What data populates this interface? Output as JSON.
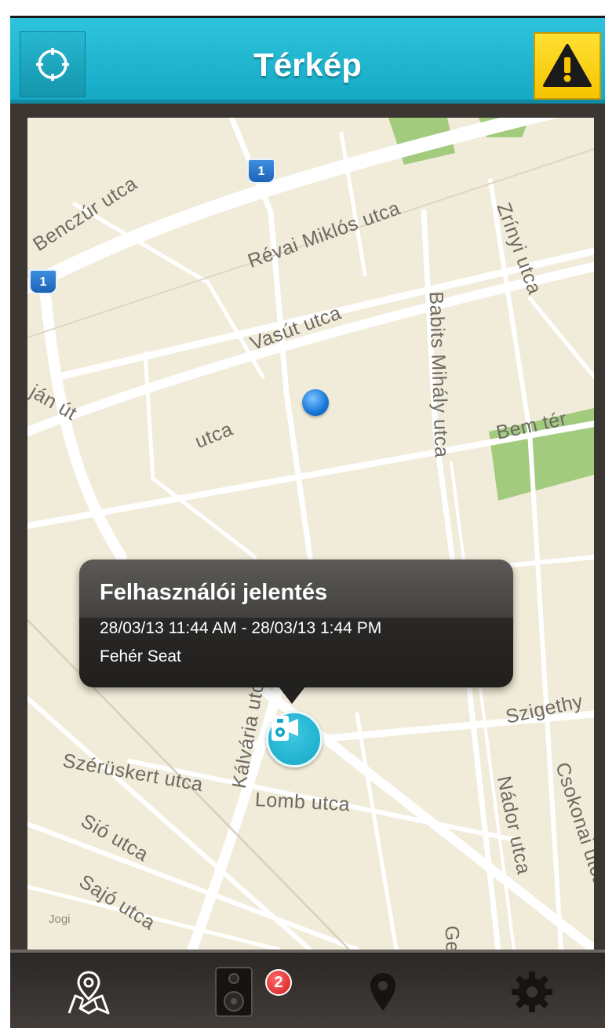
{
  "header": {
    "title": "Térkép"
  },
  "map": {
    "streets": [
      "Benczúr utca",
      "Révai Miklós utca",
      "Zrínyi utca",
      "Vasút utca",
      "Babits Mihály utca",
      "Bem tér",
      "ján út",
      "utca",
      "utca",
      "Kálvária utca",
      "Szigethy",
      "Szérüskert utca",
      "Lomb utca",
      "Nádor utca",
      "Csokonai utca",
      "Sió utca",
      "Sajó utca",
      "Ger"
    ],
    "route_shields": [
      "1",
      "1"
    ],
    "attribution": "Jogi"
  },
  "callout": {
    "title": "Felhasználói jelentés",
    "time_range": "28/03/13 11:44 AM - 28/03/13 1:44 PM",
    "description": "Fehér Seat"
  },
  "tabbar": {
    "items": [
      {
        "icon": "map-icon",
        "active": true
      },
      {
        "icon": "reports-icon",
        "badge": "2"
      },
      {
        "icon": "location-pin-icon"
      },
      {
        "icon": "gear-icon"
      }
    ]
  },
  "colors": {
    "header": "#1fb6d1",
    "alert": "#f6c400",
    "pin": "#14a6c4",
    "badge": "#d11a1a",
    "park": "#9ec97a",
    "map_bg": "#f1ebd9"
  }
}
